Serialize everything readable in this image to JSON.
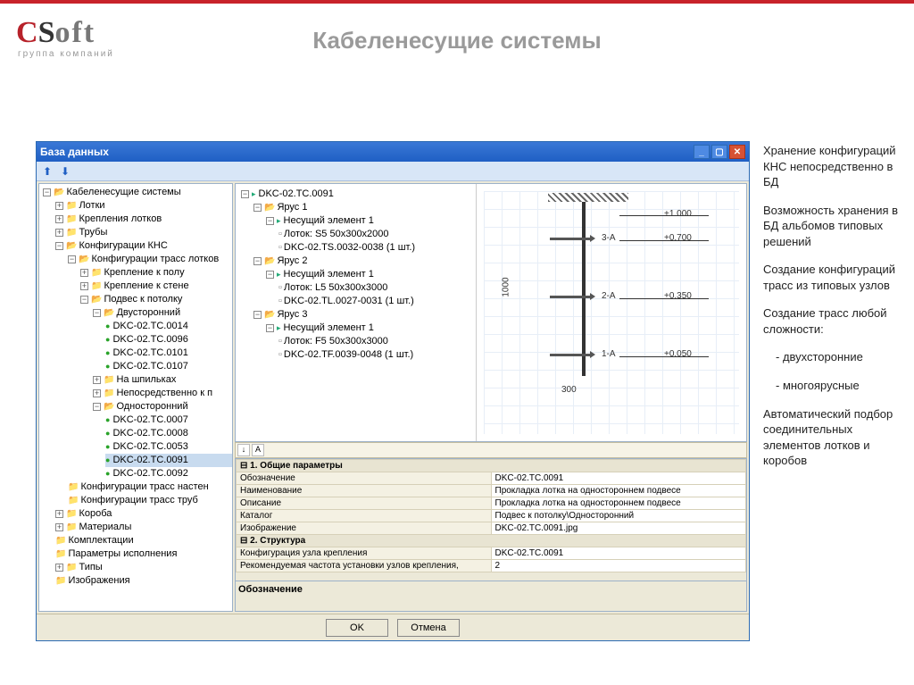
{
  "page": {
    "logo_sub": "группа компаний",
    "title": "Кабеленесущие системы"
  },
  "bullets": {
    "b1": "Хранение конфигураций КНС непосредственно в БД",
    "b2": "Возможность хранения в БД альбомов типовых решений",
    "b3": "Создание конфигураций трасс из типовых узлов",
    "b4": "Создание трасс любой сложности:",
    "b4a": "- двухсторонние",
    "b4b": "- многоярусные",
    "b5": "Автоматический подбор соединительных элементов лотков и коробов"
  },
  "window": {
    "title": "База данных"
  },
  "left_tree": {
    "root": "Кабеленесущие системы",
    "n_lotki": "Лотки",
    "n_krepl": "Крепления лотков",
    "n_truby": "Трубы",
    "n_konf": "Конфигурации КНС",
    "n_ktl": "Конфигурации трасс лотков",
    "n_kpol": "Крепление к полу",
    "n_ksten": "Крепление к стене",
    "n_podv": "Подвес к потолку",
    "n_dvust": "Двусторонний",
    "d1": "DKC-02.TC.0014",
    "d2": "DKC-02.TC.0096",
    "d3": "DKC-02.TC.0101",
    "d4": "DKC-02.TC.0107",
    "n_shpil": "На шпильках",
    "n_nepot": "Непосредственно к п",
    "n_odnost": "Односторонний",
    "o1": "DKC-02.TC.0007",
    "o2": "DKC-02.TC.0008",
    "o3": "DKC-02.TC.0053",
    "o4": "DKC-02.TC.0091",
    "o5": "DKC-02.TC.0092",
    "n_ktn": "Конфигурации трасс настен",
    "n_ktr": "Конфигурации трасс труб",
    "n_koroba": "Короба",
    "n_mat": "Материалы",
    "n_komp": "Комплектации",
    "n_param": "Параметры исполнения",
    "n_tipy": "Типы",
    "n_izob": "Изображения"
  },
  "right_tree": {
    "root": "DKC-02.TC.0091",
    "y1": "Ярус 1",
    "y1_ne": "Несущий элемент 1",
    "y1_l": "Лоток: S5 50x300x2000",
    "y1_d": "DKC-02.TS.0032-0038 (1 шт.)",
    "y2": "Ярус 2",
    "y2_ne": "Несущий элемент 1",
    "y2_l": "Лоток: L5 50x300x3000",
    "y2_d": "DKC-02.TL.0027-0031 (1 шт.)",
    "y3": "Ярус 3",
    "y3_ne": "Несущий элемент 1",
    "y3_l": "Лоток: F5 50x300x3000",
    "y3_d": "DKC-02.TF.0039-0048 (1 шт.)"
  },
  "drawing": {
    "v_dim": "1000",
    "h_dim": "300",
    "lvl1_name": "3-A",
    "lvl1_val": "+0.700",
    "lvl2_name": "2-A",
    "lvl2_val": "+0.350",
    "lvl3_name": "1-A",
    "lvl3_val": "+0.050",
    "top_val": "+1.000"
  },
  "props": {
    "g1": "1. Общие параметры",
    "r1k": "Обозначение",
    "r1v": "DKC-02.TC.0091",
    "r2k": "Наименование",
    "r2v": "Прокладка лотка на одностороннем подвесе",
    "r3k": "Описание",
    "r3v": "Прокладка лотка на одностороннем подвесе",
    "r4k": "Каталог",
    "r4v": "Подвес к потолку\\Односторонний",
    "r5k": "Изображение",
    "r5v": "DKC-02.TC.0091.jpg",
    "g2": "2. Структура",
    "r6k": "Конфигурация узла крепления",
    "r6v": "DKC-02.TC.0091",
    "r7k": "Рекомендуемая частота установки узлов крепления,",
    "r7v": "2",
    "desc": "Обозначение"
  },
  "buttons": {
    "ok": "OK",
    "cancel": "Отмена"
  }
}
